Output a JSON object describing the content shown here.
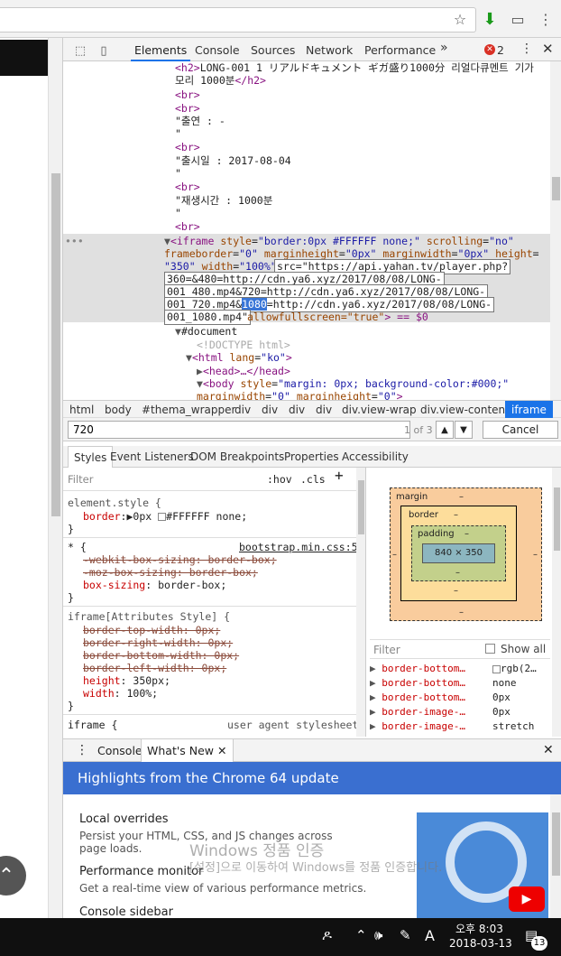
{
  "devtools": {
    "tabs": [
      "Elements",
      "Console",
      "Sources",
      "Network",
      "Performance"
    ],
    "more_tabs": "»",
    "error_count": "2",
    "dom": {
      "h2_line1": "LONG-001 1 リアルドキュメント ギガ盛り1000分 리얼다큐멘트 기가",
      "h2_line2": "모리 1000분",
      "text_cast": "\"출연 : -",
      "text_release": "\"출시일 : 2017-08-04",
      "text_runtime": "\"재생시간 : 1000분",
      "quote": "\"",
      "iframe_style_val": "\"border:0px #FFFFFF none;\"",
      "iframe_scrolling_val": "\"no\"",
      "iframe_fb_val": "\"0\"",
      "iframe_mh_val": "\"0px\"",
      "iframe_mw_val": "\"0px\"",
      "iframe_h_val": "\"350\"",
      "iframe_w_val": "\"100%\"",
      "src_l1": "src=\"https://api.yahan.tv/player.php?",
      "src_l2": "360=&480=http://cdn.ya6.xyz/2017/08/08/LONG-",
      "src_l3": "001_480.mp4&720=http://cdn.ya6.xyz/2017/08/08/LONG-",
      "src_l4a": "001_720.mp4&",
      "src_l4_hl": "1080",
      "src_l4b": "=http://cdn.ya6.xyz/2017/08/08/LONG-",
      "src_l5": "001_1080.mp4\"",
      "allowfs": "allowfullscreen=\"true\"",
      "eq": "> == $0",
      "document": "#document",
      "doctype": "<!DOCTYPE html>",
      "html_lang_val": "\"ko\"",
      "head": "<head>…</head>",
      "body_style_val": "\"margin: 0px; background-color:#000;\"",
      "body_mw_val": "\"0\"",
      "body_mh_val": "\"0\""
    },
    "breadcrumbs": [
      "html",
      "body",
      "#thema_wrapper",
      "div",
      "div",
      "div",
      "div",
      "div.view-wrap",
      "div.view-content",
      "iframe"
    ],
    "search": {
      "value": "720",
      "count": "1 of 3",
      "cancel": "Cancel"
    },
    "styles_tabs": [
      "Styles",
      "Event Listeners",
      "DOM Breakpoints",
      "Properties",
      "Accessibility"
    ],
    "styles": {
      "filter_placeholder": "Filter",
      "hov": ":hov",
      "cls": ".cls",
      "plus": "+",
      "element_style": "element.style {",
      "border_prop": "border",
      "border_val": "0px",
      "border_val2": "#FFFFFF none;",
      "close": "}",
      "star_sel": "* {",
      "bootstrap": "bootstrap.min.css:5",
      "webkit_bs": "-webkit-box-sizing: border-box;",
      "moz_bs": "-moz-box-sizing: border-box;",
      "box_sizing_prop": "box-sizing",
      "box_sizing_val": "border-box;",
      "iframe_attr": "iframe[Attributes Style] {",
      "btw": "border-top-width: 0px;",
      "brw": "border-right-width: 0px;",
      "bbw": "border-bottom-width: 0px;",
      "blw": "border-left-width: 0px;",
      "height_prop": "height",
      "height_val": "350px;",
      "width_prop": "width",
      "width_val": "100%;",
      "iframe_ua": "iframe {",
      "ua": "user agent stylesheet"
    },
    "box_model": {
      "margin": "margin",
      "border": "border",
      "padding": "padding",
      "content": "840 × 350",
      "dash": "–"
    },
    "computed": {
      "filter_placeholder": "Filter",
      "show_all": "Show all",
      "rows": [
        {
          "prop": "border-bottom…",
          "val": "rgb(2…"
        },
        {
          "prop": "border-bottom…",
          "val": "none"
        },
        {
          "prop": "border-bottom…",
          "val": "0px"
        },
        {
          "prop": "border-image-…",
          "val": "0px"
        },
        {
          "prop": "border-image-…",
          "val": "stretch"
        }
      ]
    },
    "drawer": {
      "console": "Console",
      "whats_new": "What's New",
      "banner": "Highlights from the Chrome 64 update",
      "items": [
        {
          "title": "Local overrides",
          "desc": "Persist your HTML, CSS, and JS changes across page loads."
        },
        {
          "title": "Performance monitor",
          "desc": "Get a real-time view of various performance metrics."
        },
        {
          "title": "Console sidebar",
          "desc": ""
        }
      ],
      "watermark_line1": "Windows 정품 인증",
      "watermark_line2": "[설정]으로 이동하여 Windows를 정품 인증합니다."
    }
  },
  "taskbar": {
    "time": "오후 8:03",
    "date": "2018-03-13",
    "ime": "A",
    "notif_count": "13"
  }
}
